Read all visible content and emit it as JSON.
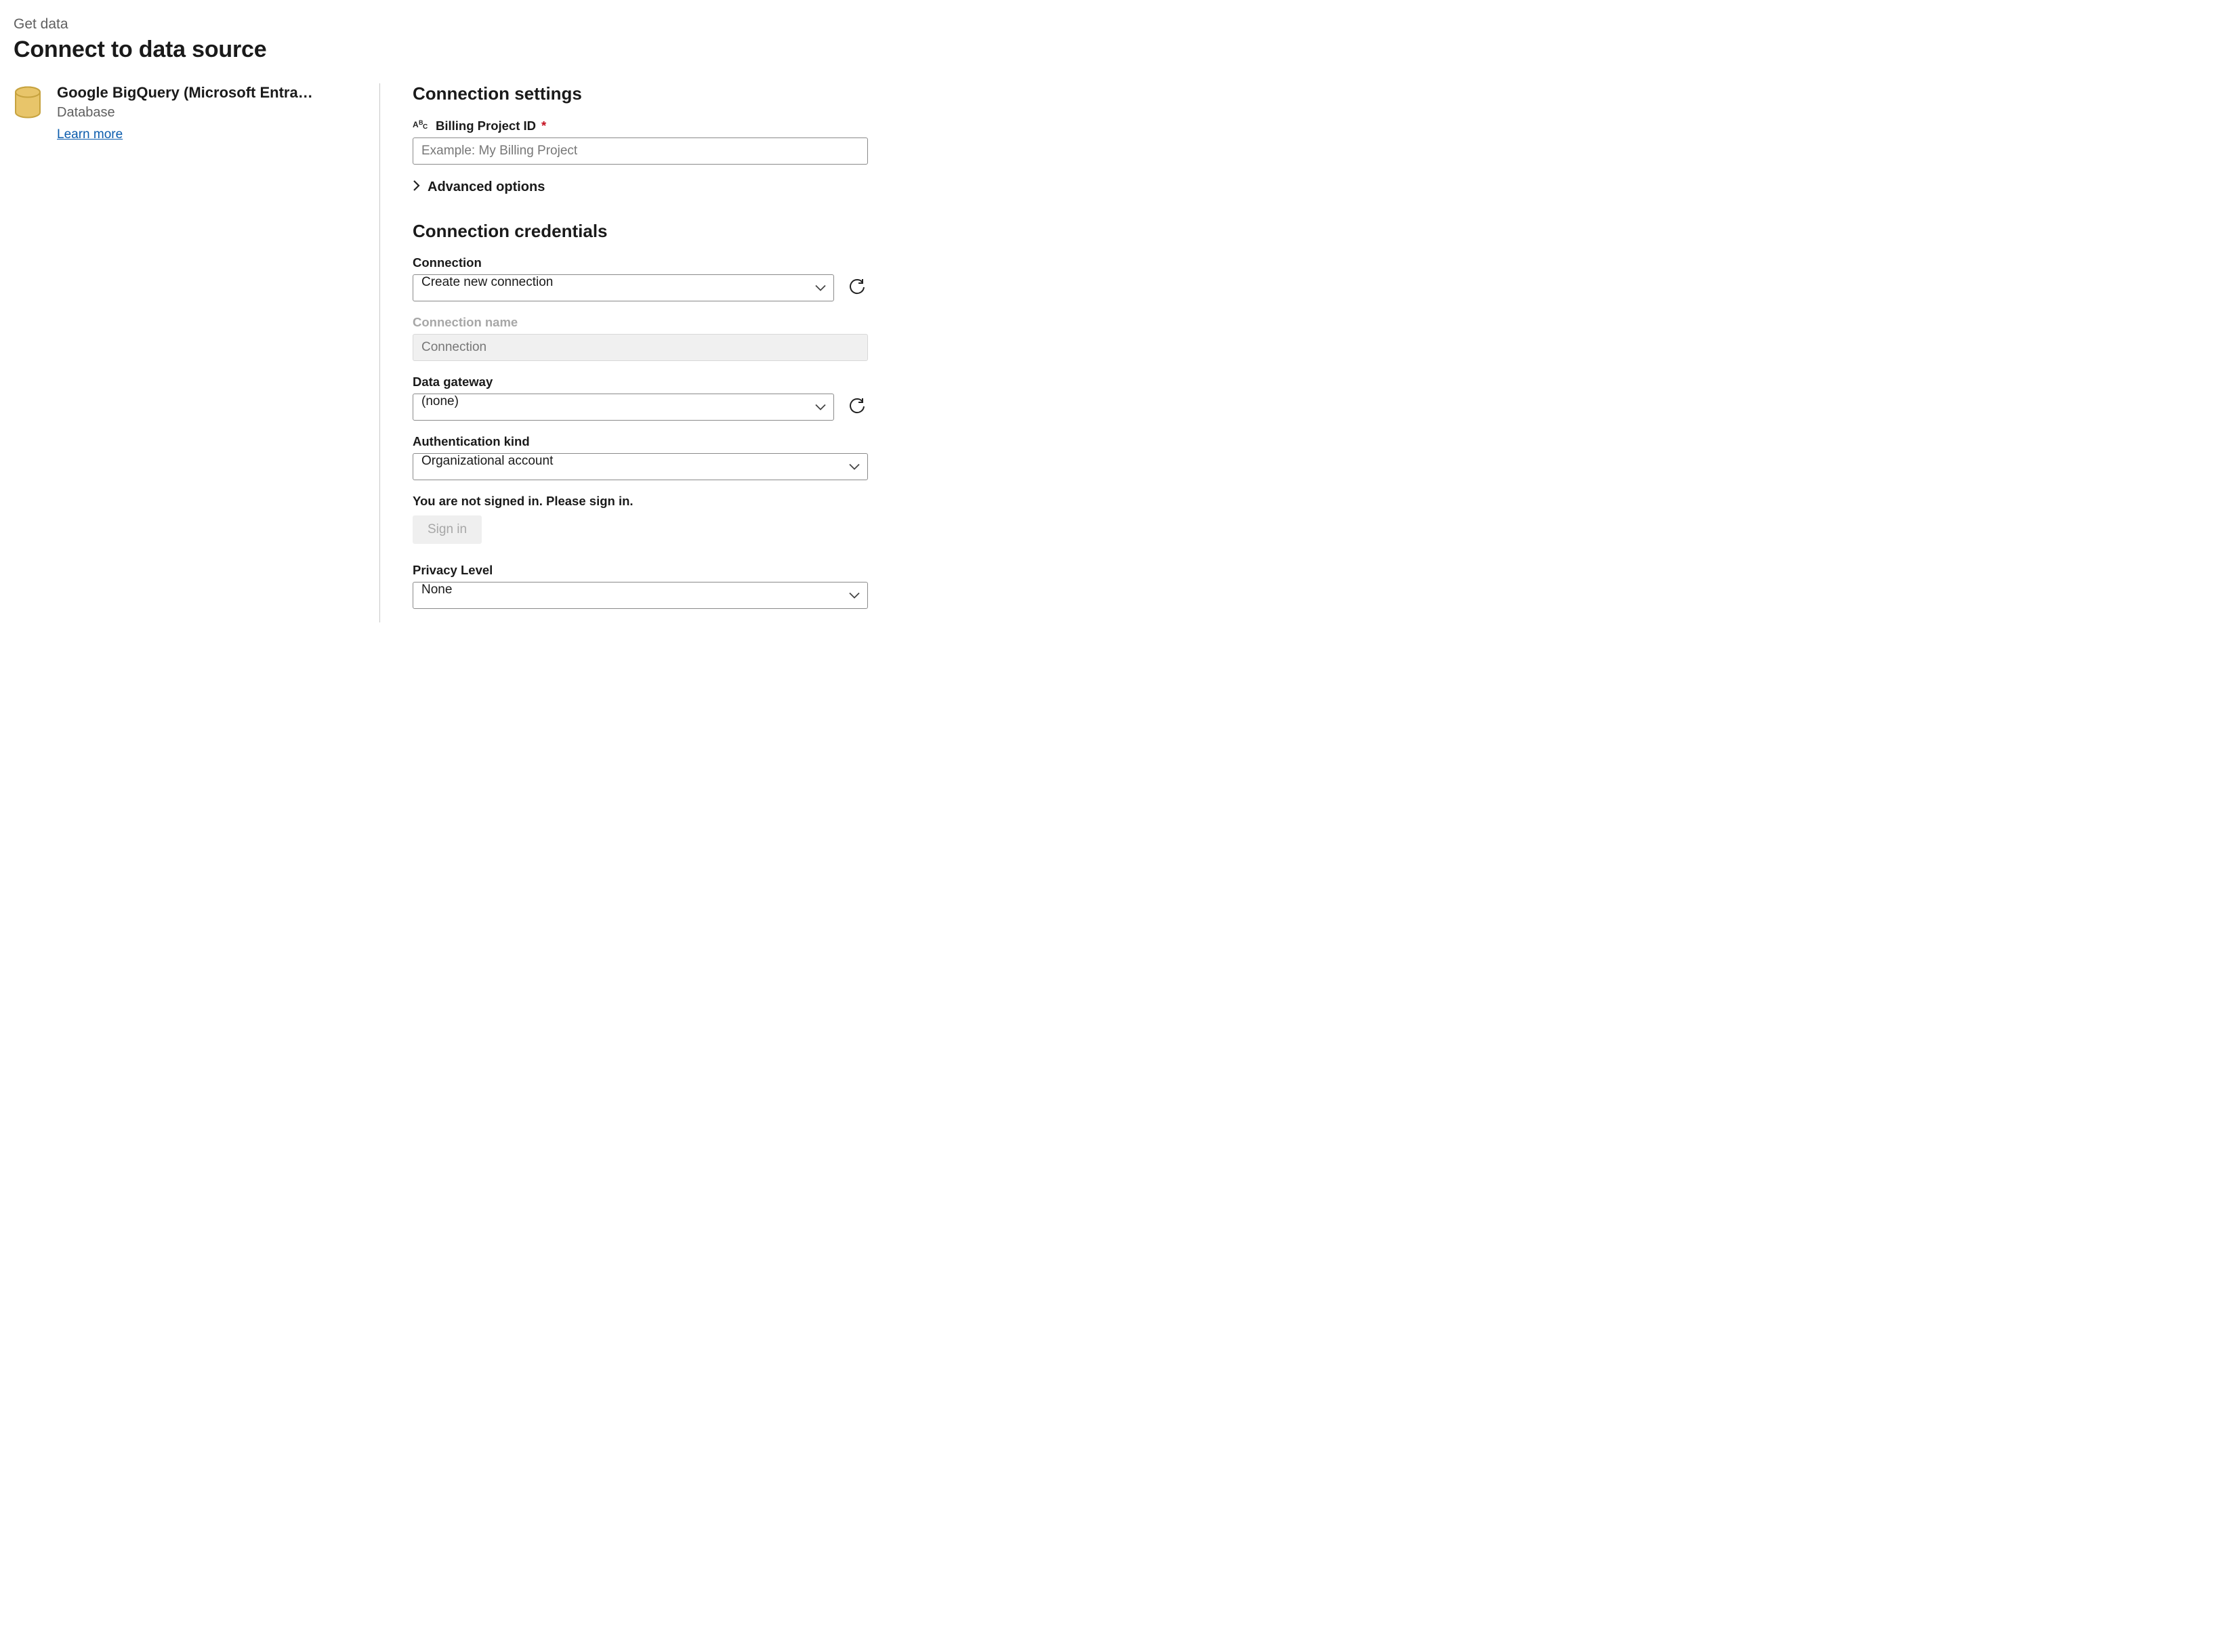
{
  "header": {
    "breadcrumb": "Get data",
    "title": "Connect to data source"
  },
  "source": {
    "name": "Google BigQuery (Microsoft Entra…",
    "category": "Database",
    "learn_more_label": "Learn more"
  },
  "settings": {
    "section_title": "Connection settings",
    "billing_project": {
      "label": "Billing Project ID",
      "placeholder": "Example: My Billing Project",
      "value": ""
    },
    "advanced_label": "Advanced options"
  },
  "credentials": {
    "section_title": "Connection credentials",
    "connection": {
      "label": "Connection",
      "value": "Create new connection"
    },
    "connection_name": {
      "label": "Connection name",
      "placeholder": "Connection",
      "value": ""
    },
    "data_gateway": {
      "label": "Data gateway",
      "value": "(none)"
    },
    "auth_kind": {
      "label": "Authentication kind",
      "value": "Organizational account"
    },
    "signin_note": "You are not signed in. Please sign in.",
    "signin_button": "Sign in",
    "privacy": {
      "label": "Privacy Level",
      "value": "None"
    }
  }
}
